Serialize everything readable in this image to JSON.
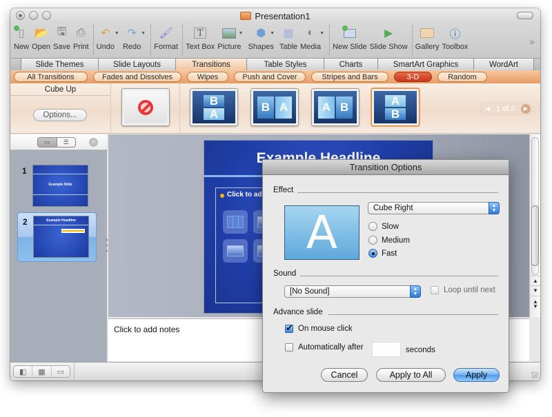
{
  "window": {
    "title": "Presentation1"
  },
  "toolbar": {
    "items": [
      {
        "label": "New",
        "icon": "new-icon"
      },
      {
        "label": "Open",
        "icon": "open-icon"
      },
      {
        "label": "Save",
        "icon": "save-icon"
      },
      {
        "label": "Print",
        "icon": "print-icon"
      },
      {
        "label": "Undo",
        "icon": "undo-icon"
      },
      {
        "label": "Redo",
        "icon": "redo-icon"
      },
      {
        "label": "Format",
        "icon": "format-brush-icon"
      },
      {
        "label": "Text Box",
        "icon": "text-box-icon"
      },
      {
        "label": "Picture",
        "icon": "picture-icon"
      },
      {
        "label": "Shapes",
        "icon": "shapes-icon"
      },
      {
        "label": "Table",
        "icon": "table-icon"
      },
      {
        "label": "Media",
        "icon": "media-icon"
      },
      {
        "label": "New Slide",
        "icon": "new-slide-icon"
      },
      {
        "label": "Slide Show",
        "icon": "slide-show-icon"
      },
      {
        "label": "Gallery",
        "icon": "gallery-icon"
      },
      {
        "label": "Toolbox",
        "icon": "toolbox-icon"
      }
    ],
    "overflow": "»"
  },
  "ribbon": {
    "tabs": [
      "Slide Themes",
      "Slide Layouts",
      "Transitions",
      "Table Styles",
      "Charts",
      "SmartArt Graphics",
      "WordArt"
    ],
    "active_tab": "Transitions",
    "filters": [
      "All Transitions",
      "Fades and Dissolves",
      "Wipes",
      "Push and Cover",
      "Stripes and Bars",
      "3-D",
      "Random"
    ],
    "active_filter": "3-D",
    "effect_name": "Cube Up",
    "options_label": "Options...",
    "thumbnails": [
      {
        "name": "No Transition",
        "glyph": ""
      },
      {
        "name": "Cube Down",
        "glyph": "B/A"
      },
      {
        "name": "Cube Left",
        "glyph": "B A"
      },
      {
        "name": "Cube Right",
        "glyph": "A B"
      },
      {
        "name": "Cube Up",
        "glyph": "A/B",
        "selected": true
      }
    ],
    "pager": "1 of 2"
  },
  "slides": [
    {
      "number": "1",
      "title": "Example Slide"
    },
    {
      "number": "2",
      "title": "Example Headline",
      "selected": true
    }
  ],
  "main_slide": {
    "heading": "Example Headline",
    "placeholder": "Click to add text"
  },
  "notes": {
    "placeholder": "Click to add notes"
  },
  "dialog": {
    "title": "Transition Options",
    "effect_label": "Effect",
    "preview_glyph": "A",
    "effect_value": "Cube Right",
    "speeds": [
      {
        "label": "Slow",
        "selected": false
      },
      {
        "label": "Medium",
        "selected": false
      },
      {
        "label": "Fast",
        "selected": true
      }
    ],
    "sound_label": "Sound",
    "sound_value": "[No Sound]",
    "loop_label": "Loop until next",
    "loop_checked": false,
    "advance_label": "Advance slide",
    "on_click_label": "On mouse click",
    "on_click_checked": true,
    "auto_label": "Automatically after",
    "auto_checked": false,
    "auto_value": "",
    "seconds_label": "seconds",
    "cancel_label": "Cancel",
    "apply_all_label": "Apply to All",
    "apply_label": "Apply"
  },
  "colors": {
    "ribbon_accent": "#e89c62",
    "active_filter": "#d04a28",
    "slide_blue": "#1f3ea8",
    "selection_blue": "#4b9cef"
  }
}
